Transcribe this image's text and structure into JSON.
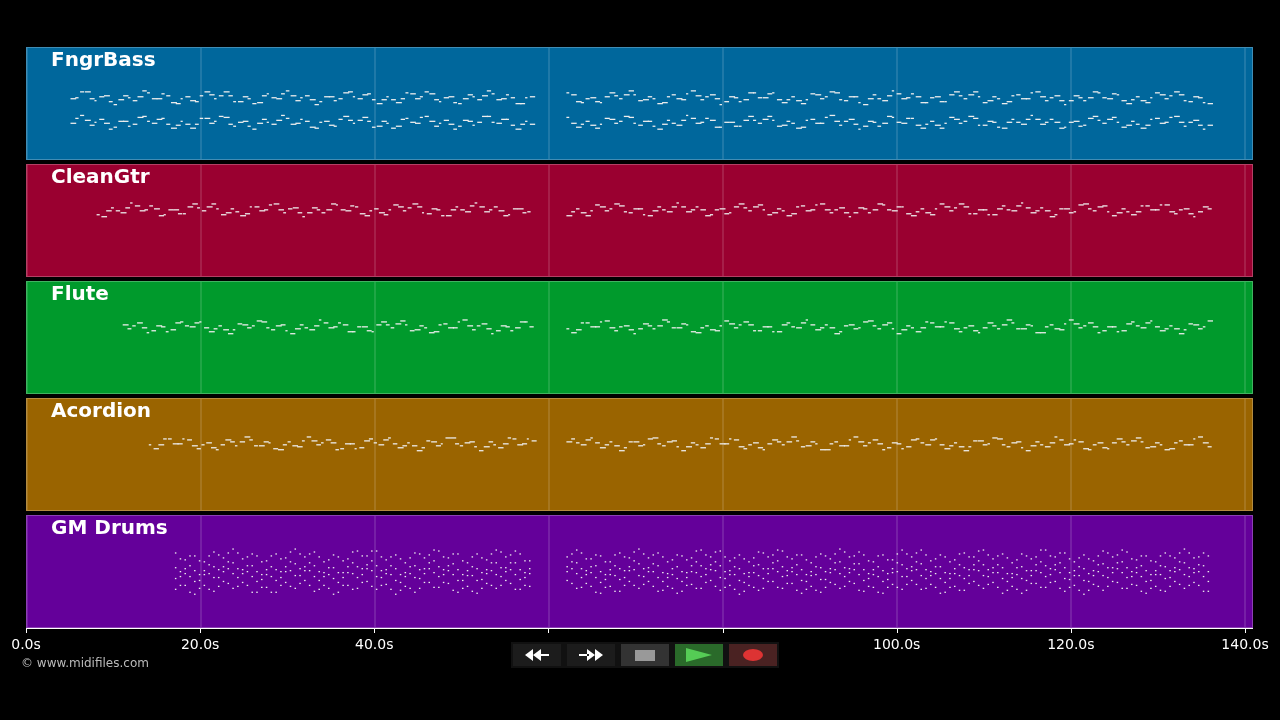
{
  "tracks": [
    {
      "name": "FngrBass",
      "color": "#00679c"
    },
    {
      "name": "CleanGtr",
      "color": "#9a0030"
    },
    {
      "name": "Flute",
      "color": "#009a2c"
    },
    {
      "name": "Acordion",
      "color": "#9a6400"
    },
    {
      "name": "GM Drums",
      "color": "#64009a"
    }
  ],
  "time_axis": {
    "ticks_left": [
      "0.0s",
      "20.0s",
      "40.0s"
    ],
    "ticks_right": [
      "100.0s",
      "120.0s",
      "140.0s"
    ]
  },
  "transport": [
    {
      "kind": "rewind"
    },
    {
      "kind": "forward"
    },
    {
      "kind": "stop"
    },
    {
      "kind": "play"
    },
    {
      "kind": "record"
    }
  ],
  "footer": "© www.midifiles.com"
}
